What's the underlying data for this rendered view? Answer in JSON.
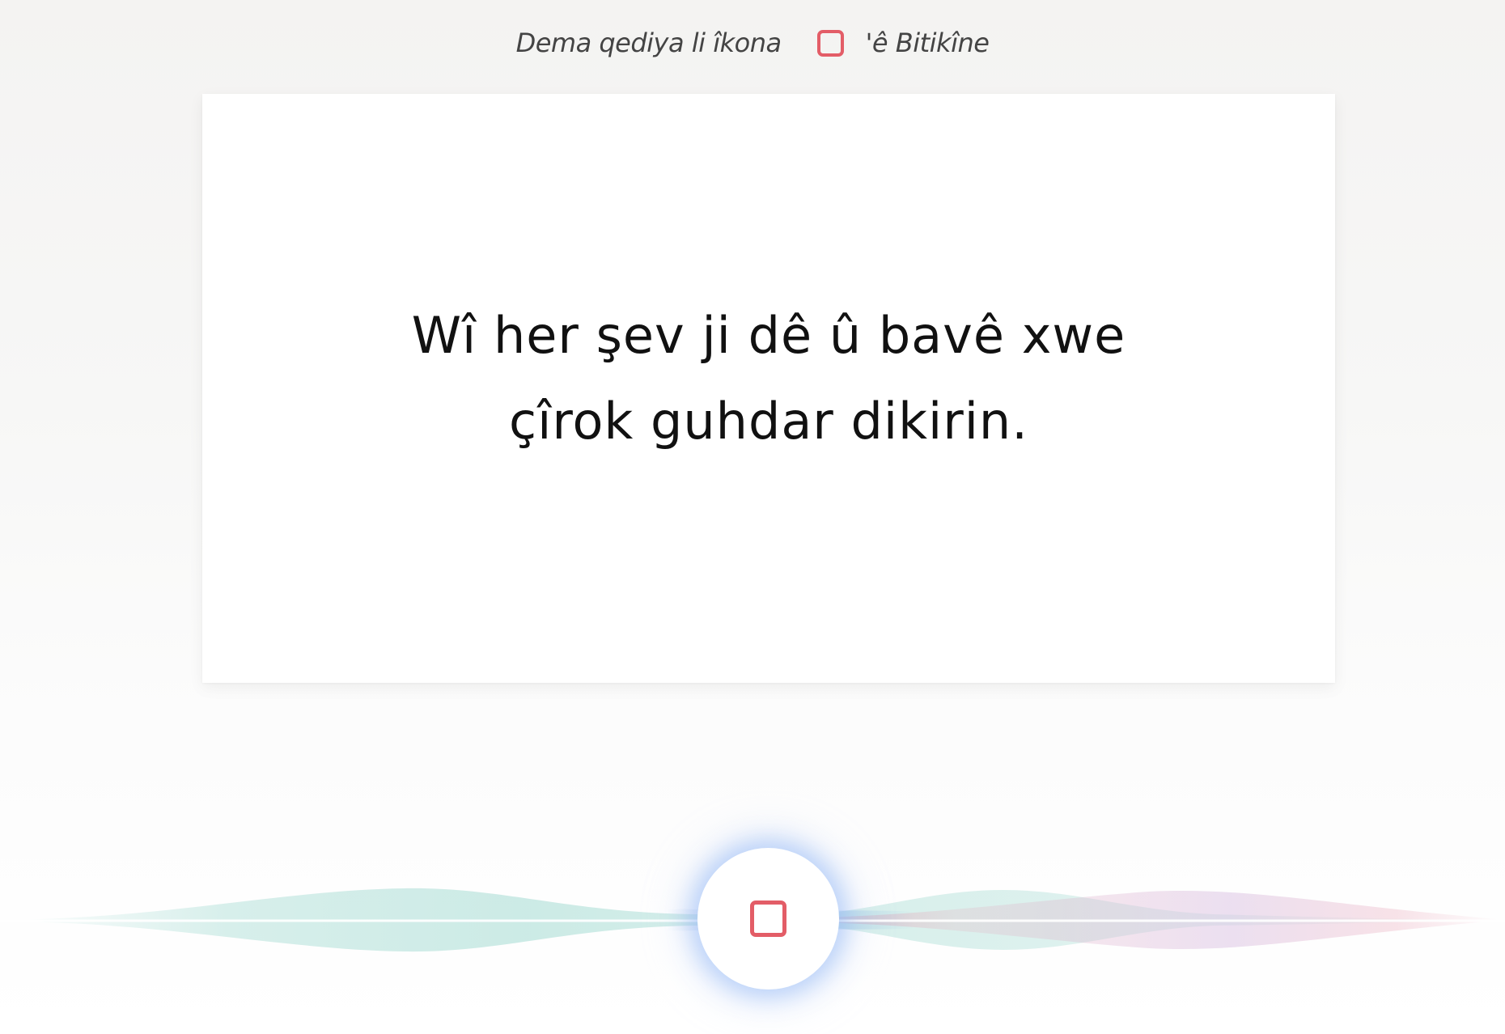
{
  "instruction": {
    "before_icon": "Dema qediya li îkona",
    "icon": "stop-square-icon",
    "after_icon": "'ê Bitikîne"
  },
  "prompt": {
    "line1": "Wî her şev ji dê û bavê xwe",
    "line2": "çîrok guhdar dikirin."
  },
  "record_button": {
    "icon": "stop-square-icon",
    "state": "recording"
  },
  "colors": {
    "accent_red": "#e35d67",
    "wave_teal": "#8fd3c8",
    "wave_pink": "#e8a0b4",
    "wave_blue": "#8ab6e0",
    "wave_purple": "#c9a6d6",
    "glow_blue": "#96b9f5"
  }
}
